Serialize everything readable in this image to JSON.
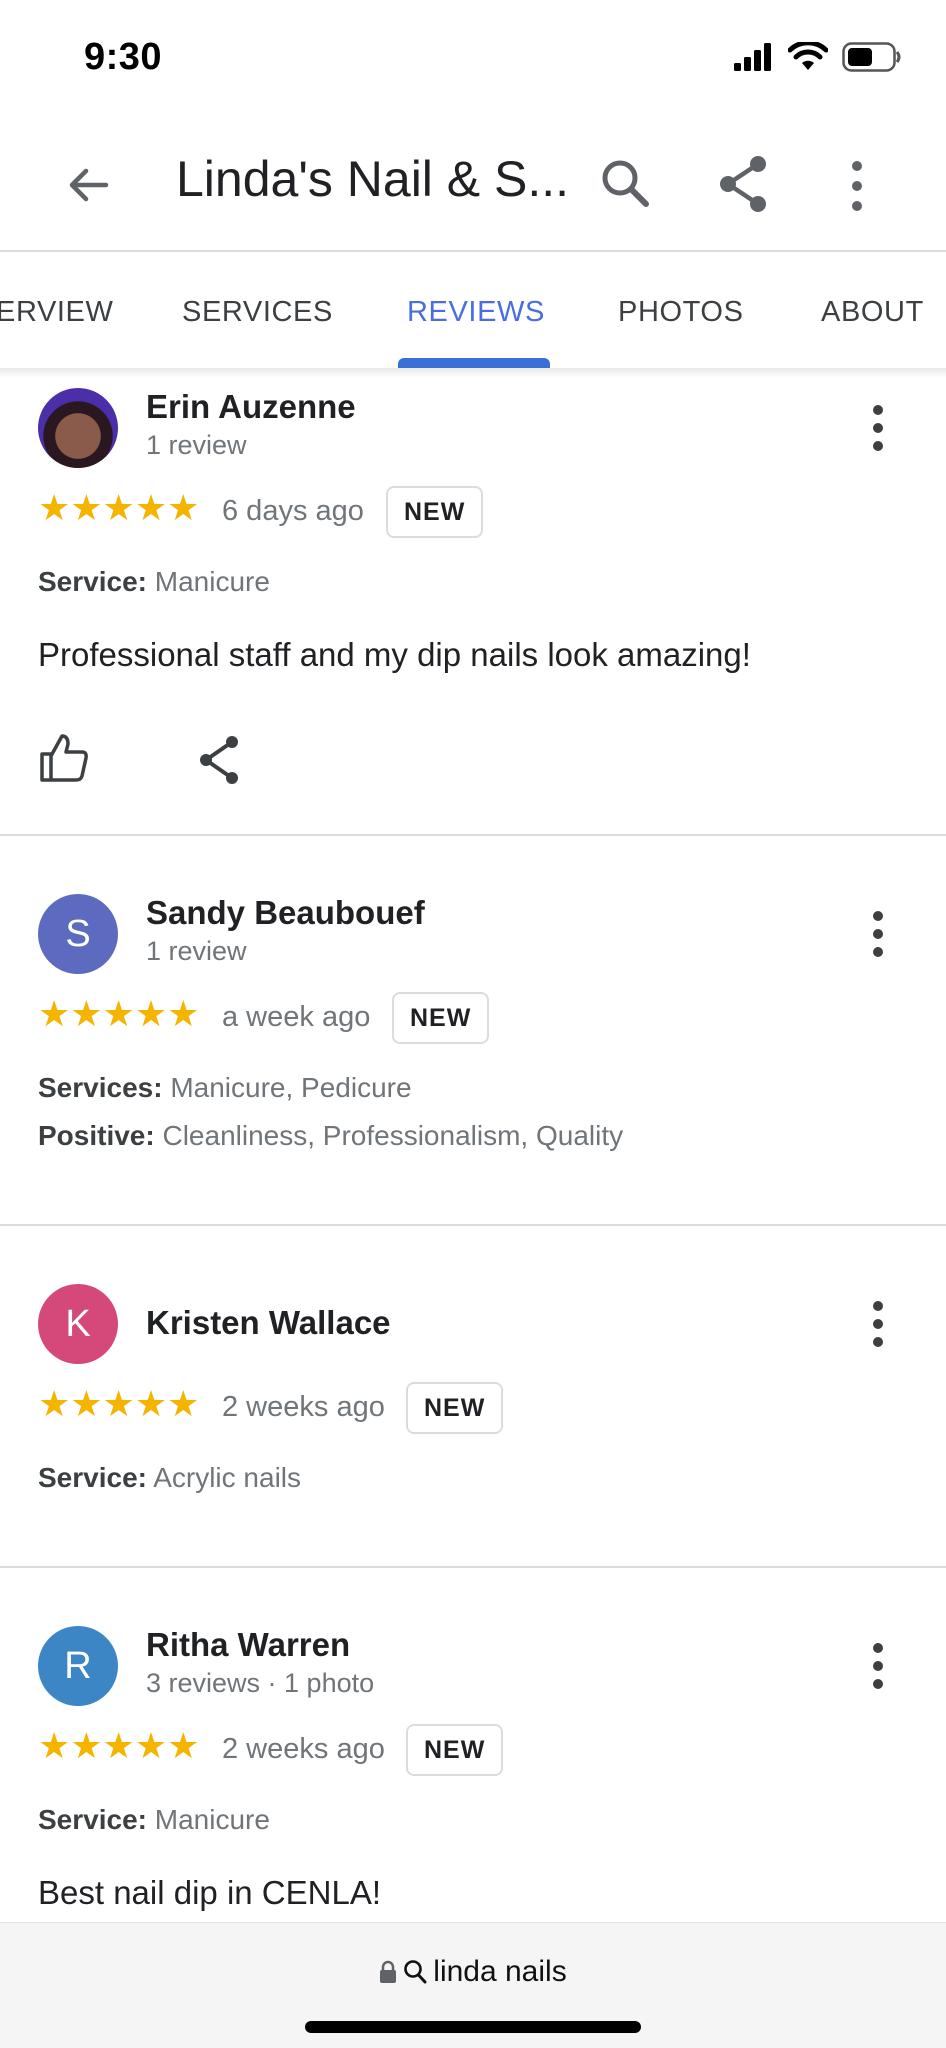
{
  "status_bar": {
    "time": "9:30"
  },
  "app_bar": {
    "title": "Linda's Nail & S..."
  },
  "tabs": [
    {
      "label": "ERVIEW"
    },
    {
      "label": "SERVICES"
    },
    {
      "label": "REVIEWS"
    },
    {
      "label": "PHOTOS"
    },
    {
      "label": "ABOUT"
    }
  ],
  "active_tab": "REVIEWS",
  "stars_glyph": "★★★★★",
  "reviews": [
    {
      "name": "Erin Auzenne",
      "meta": "1 review",
      "rating": 5,
      "time": "6 days ago",
      "badge": "NEW",
      "attrs": [
        {
          "label": "Service:",
          "value": "Manicure"
        }
      ],
      "text": "Professional staff and my dip nails look amazing!"
    },
    {
      "name": "Sandy Beaubouef",
      "meta": "1 review",
      "avatar_letter": "S",
      "avatar_color": "#5c6bc0",
      "rating": 5,
      "time": "a week ago",
      "badge": "NEW",
      "attrs": [
        {
          "label": "Services:",
          "value": "Manicure, Pedicure"
        },
        {
          "label": "Positive:",
          "value": "Cleanliness, Professionalism, Quality"
        }
      ]
    },
    {
      "name": "Kristen Wallace",
      "avatar_letter": "K",
      "avatar_color": "#d4497a",
      "rating": 5,
      "time": "2 weeks ago",
      "badge": "NEW",
      "attrs": [
        {
          "label": "Service:",
          "value": "Acrylic nails"
        }
      ]
    },
    {
      "name": "Ritha Warren",
      "meta": "3 reviews · 1 photo",
      "avatar_letter": "R",
      "avatar_color": "#3d86c6",
      "rating": 5,
      "time": "2 weeks ago",
      "badge": "NEW",
      "attrs": [
        {
          "label": "Service:",
          "value": "Manicure"
        }
      ],
      "text": "Best nail dip in CENLA!"
    }
  ],
  "url_bar": {
    "text": "linda nails"
  },
  "icons": [
    "back-arrow-icon",
    "search-icon",
    "share-icon",
    "more-vert-icon",
    "thumbs-up-icon",
    "lock-icon",
    "signal-icon",
    "wifi-icon",
    "battery-icon"
  ],
  "colors": {
    "accent": "#4a6ee0",
    "star": "#f4b400"
  }
}
